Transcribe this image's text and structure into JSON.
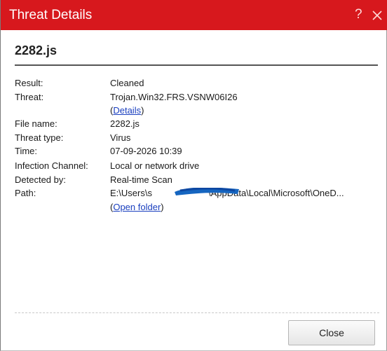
{
  "window": {
    "title": "Threat Details",
    "help_label": "?",
    "accent_color": "#d7181d"
  },
  "file": {
    "name_heading": "2282.js"
  },
  "details": {
    "result": {
      "label": "Result:",
      "value": "Cleaned"
    },
    "threat": {
      "label": "Threat:",
      "value": "Trojan.Win32.FRS.VSNW06I26",
      "link": "Details"
    },
    "file_name": {
      "label": "File name:",
      "value": "2282.js"
    },
    "threat_type": {
      "label": "Threat type:",
      "value": "Virus"
    },
    "time": {
      "label": "Time:",
      "value": "07-09-2026 10:39"
    },
    "infection_channel": {
      "label": "Infection Channel:",
      "value": "Local or network drive"
    },
    "detected_by": {
      "label": "Detected by:",
      "value": "Real-time Scan"
    },
    "path": {
      "label": "Path:",
      "value_prefix": "E:\\Users\\s",
      "value_suffix": "\\AppData\\Local\\Microsoft\\OneD...",
      "link": "Open folder"
    }
  },
  "footer": {
    "close_label": "Close"
  }
}
